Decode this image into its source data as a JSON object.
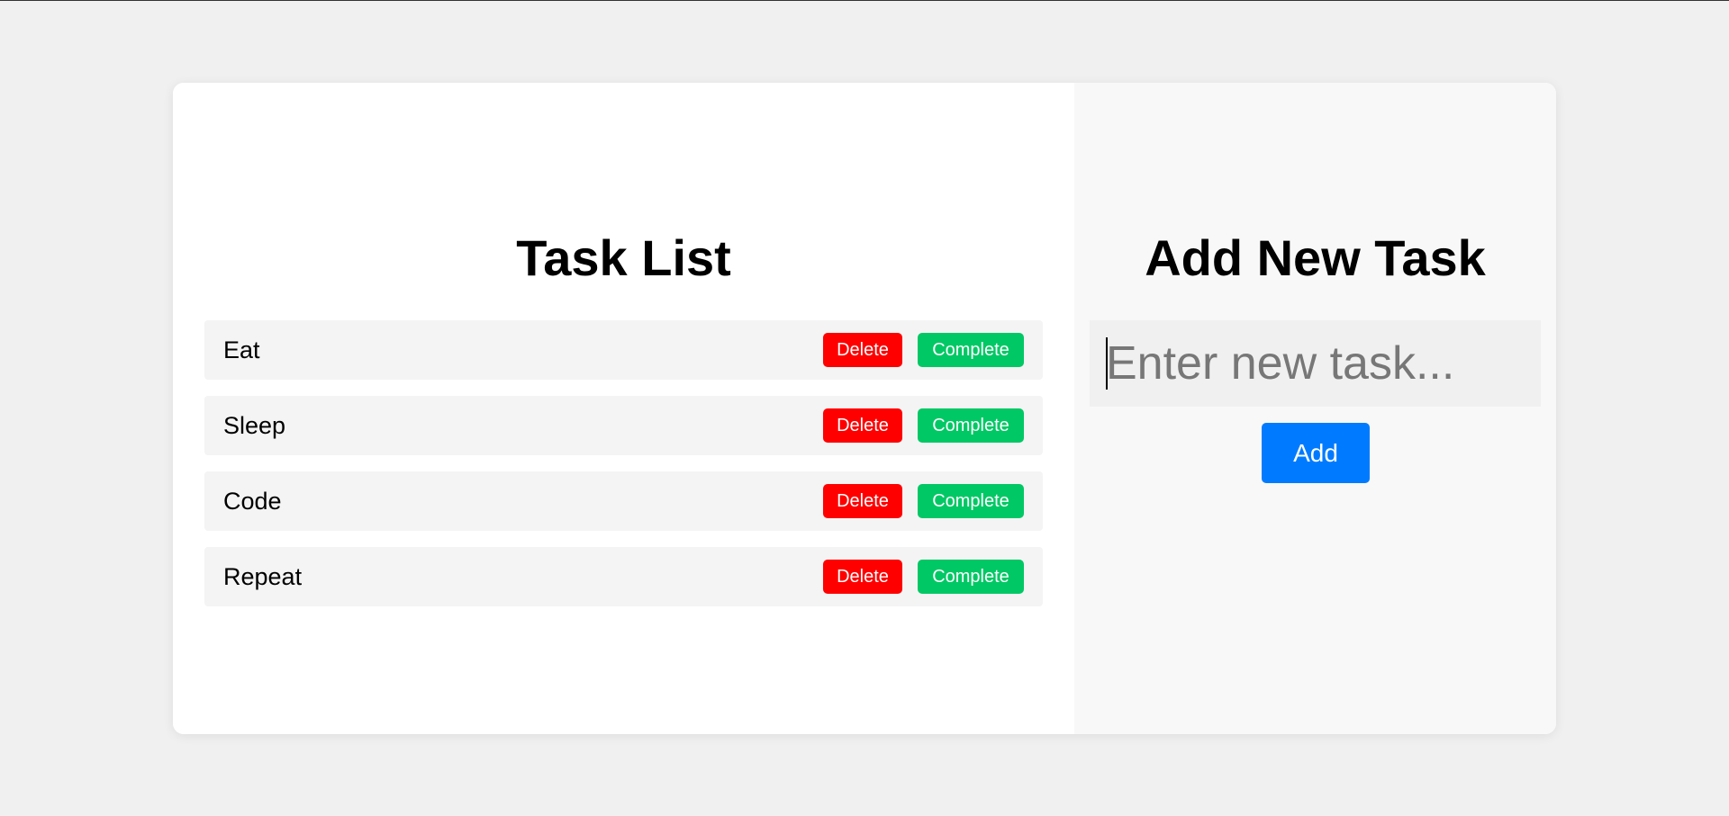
{
  "task_list": {
    "title": "Task List",
    "delete_label": "Delete",
    "complete_label": "Complete",
    "tasks": [
      {
        "name": "Eat"
      },
      {
        "name": "Sleep"
      },
      {
        "name": "Code"
      },
      {
        "name": "Repeat"
      }
    ]
  },
  "add_task": {
    "title": "Add New Task",
    "input_value": "",
    "input_placeholder": "Enter new task...",
    "add_label": "Add"
  },
  "colors": {
    "delete": "#ff0000",
    "complete": "#00c864",
    "add": "#007bff"
  }
}
